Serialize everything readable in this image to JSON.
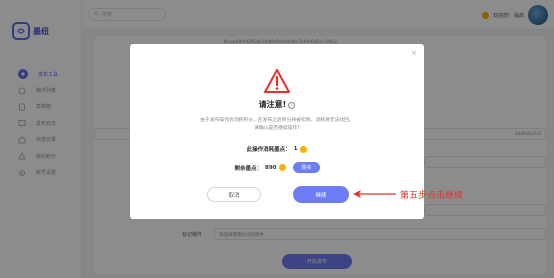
{
  "app": {
    "logo_text": "墨纽"
  },
  "topbar": {
    "search_placeholder": "搜索",
    "welcome": "欢迎您!",
    "username": "临启"
  },
  "sidebar": {
    "items": [
      {
        "label": "发布工具"
      },
      {
        "label": "稿件列表"
      },
      {
        "label": "草稿箱"
      },
      {
        "label": "发布日志"
      },
      {
        "label": "充值记录"
      },
      {
        "label": "我的积分"
      },
      {
        "label": "账号设置"
      }
    ]
  },
  "background": {
    "hash_line": "Ncppd8fsd2f0sfv7ls8fk9cdcbfs8c2c9fe6d5cc3dfc2",
    "field_right_value": "Dk8ki8d7uf",
    "row_label": "标记稿件",
    "row_placeholder": "请选择需要标记的稿件",
    "start_button": "开始发布"
  },
  "modal": {
    "title": "请注意!",
    "info_symbol": "i",
    "desc_line1": "由于发布操作会消耗积分，在发布之后积分将被扣除，消耗将无法找回。",
    "desc_line2": "请确认是否继续操作?",
    "cost_label": "此操作消耗墨点：",
    "cost_value": "1",
    "balance_label": "剩余墨点：",
    "balance_value": "890",
    "buy_label": "购买",
    "cancel_label": "取消",
    "continue_label": "继续",
    "close_symbol": "×"
  },
  "annotation": {
    "text": "第五步点击继续"
  },
  "colors": {
    "accent": "#6e7df5",
    "annotation": "#e8302a",
    "warning": "#e8302a",
    "coin": "#f5b400"
  }
}
